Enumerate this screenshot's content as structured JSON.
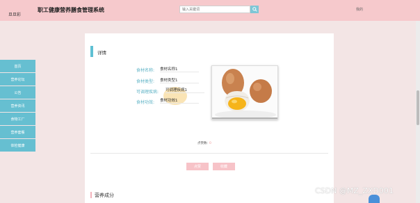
{
  "header": {
    "logo_text": "旦旦彩",
    "site_title": "职工健康营养膳食管理系统",
    "search_placeholder": "输入关键词",
    "search_icon": "search-icon",
    "user_link": "我的"
  },
  "sidebar": {
    "items": [
      {
        "label": "首页"
      },
      {
        "label": "营养论坛"
      },
      {
        "label": "公告"
      },
      {
        "label": "营养资讯"
      },
      {
        "label": "食物工厂"
      },
      {
        "label": "营养套餐"
      },
      {
        "label": "体检健康"
      }
    ]
  },
  "detail": {
    "section_title": "详情",
    "fields": [
      {
        "label": "食材名称:",
        "value": "食材名称1"
      },
      {
        "label": "食材类型:",
        "value": "食材类型1"
      },
      {
        "label": "可调理疾病:",
        "value": "可调理疾病1"
      },
      {
        "label": "食材功效:",
        "value": "食材功效1"
      }
    ],
    "image_subject": "eggs",
    "clicks_label": "点赞数:",
    "clicks_value": "0",
    "buttons": {
      "like": "点赞",
      "collect": "收藏"
    },
    "nutrition_title": "营养成分"
  },
  "colors": {
    "header": "#f6c9cc",
    "accent": "#5fc0d3",
    "sidebar": "#66bfd1",
    "button": "#f7c3c8"
  },
  "watermark": "CSDN @MZ_ZXD001"
}
